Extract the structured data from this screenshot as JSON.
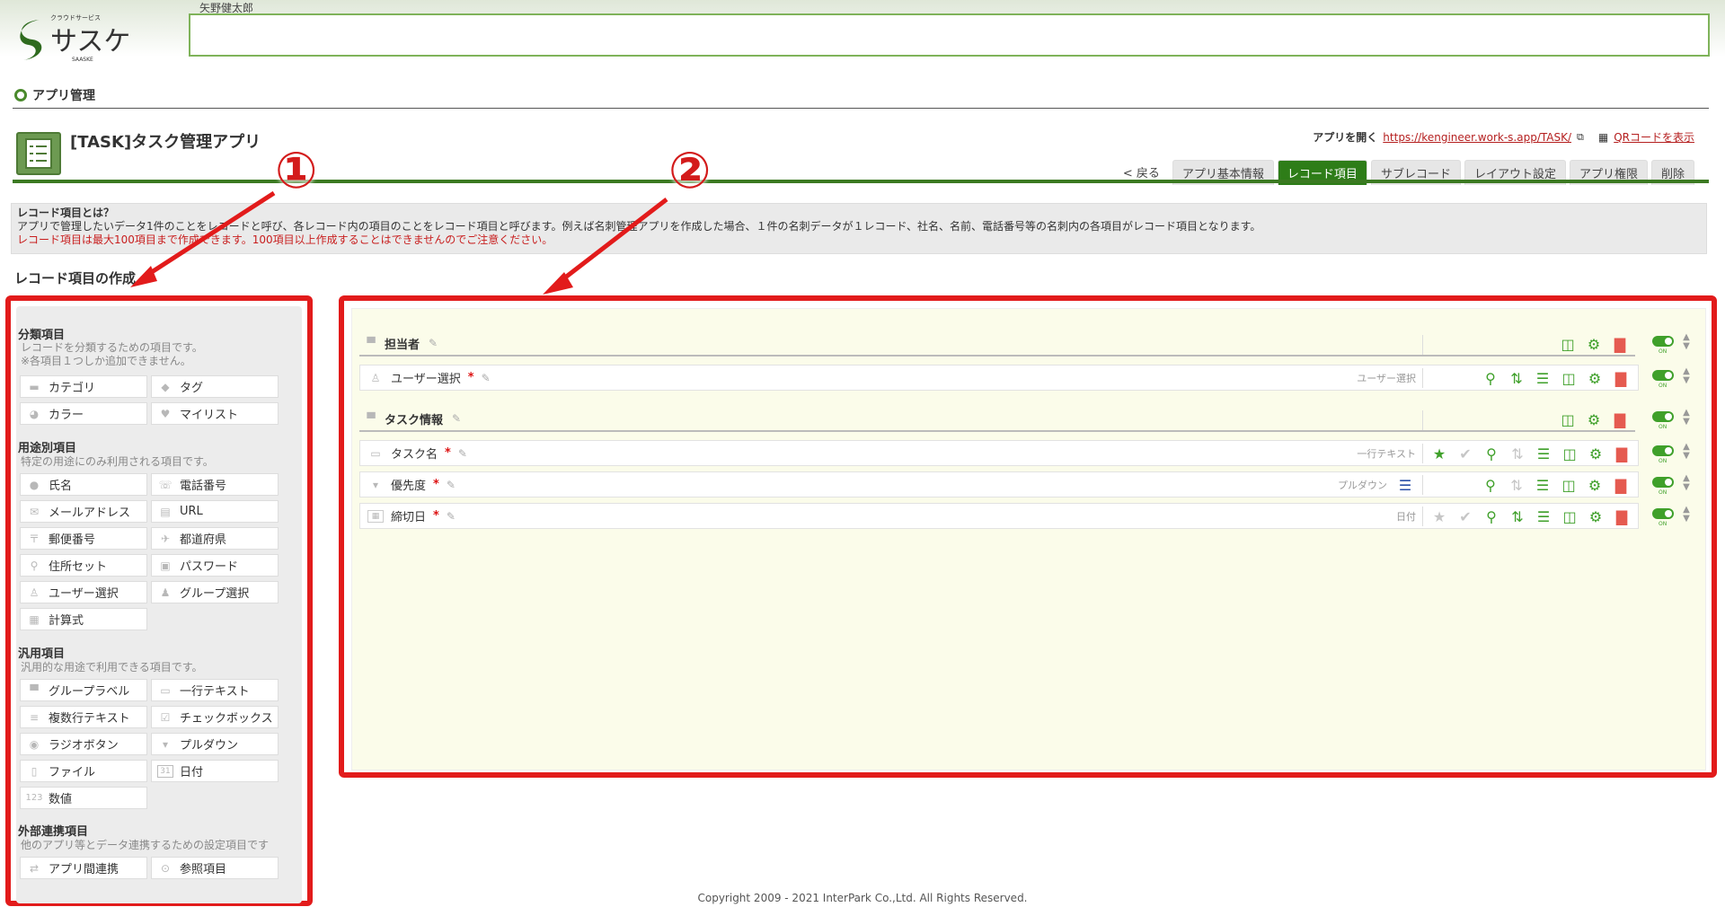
{
  "header": {
    "logo_small": "クラウドサービス",
    "logo_text": "サスケ",
    "logo_sub": "SAASKE",
    "user_name": "矢野健太郎"
  },
  "breadcrumb": "アプリ管理",
  "app": {
    "title": "[TASK]タスク管理アプリ",
    "open_label": "アプリを開く",
    "url": "https://kengineer.work-s.app/TASK/",
    "qr_label": "QRコードを表示"
  },
  "tabs": [
    "< 戻る",
    "アプリ基本情報",
    "レコード項目",
    "サブレコード",
    "レイアウト設定",
    "アプリ権限",
    "削除"
  ],
  "info": {
    "title": "レコード項目とは？",
    "line1": "アプリで管理したいデータ1件のことをレコードと呼び、各レコード内の項目のことをレコード項目と呼びます。例えば名刺管理アプリを作成した場合、１件の名刺データが１レコード、社名、名前、電話番号等の名刺内の各項目がレコード項目となります。",
    "line2": "レコード項目は最大100項目まで作成できます。100項目以上作成することはできませんのでご注意ください。"
  },
  "section_title": "レコード項目の作成",
  "left_panel": {
    "categories": [
      {
        "name": "分類項目",
        "desc": [
          "レコードを分類するための項目です。",
          "※各項目１つしか追加できません。"
        ],
        "items": [
          {
            "label": "カテゴリ",
            "icon": "folder-icon"
          },
          {
            "label": "タグ",
            "icon": "tag-icon"
          },
          {
            "label": "カラー",
            "icon": "palette-icon"
          },
          {
            "label": "マイリスト",
            "icon": "heart-icon"
          }
        ]
      },
      {
        "name": "用途別項目",
        "desc": [
          "特定の用途にのみ利用される項目です。"
        ],
        "items": [
          {
            "label": "氏名",
            "icon": "person-icon"
          },
          {
            "label": "電話番号",
            "icon": "phone-icon"
          },
          {
            "label": "メールアドレス",
            "icon": "mail-icon"
          },
          {
            "label": "URL",
            "icon": "url-icon"
          },
          {
            "label": "郵便番号",
            "icon": "postal-icon"
          },
          {
            "label": "都道府県",
            "icon": "map-icon"
          },
          {
            "label": "住所セット",
            "icon": "pin-icon"
          },
          {
            "label": "パスワード",
            "icon": "lock-icon"
          },
          {
            "label": "ユーザー選択",
            "icon": "user-icon"
          },
          {
            "label": "グループ選択",
            "icon": "group-icon"
          },
          {
            "label": "計算式",
            "icon": "calc-icon"
          }
        ]
      },
      {
        "name": "汎用項目",
        "desc": [
          "汎用的な用途で利用できる項目です。"
        ],
        "items": [
          {
            "label": "グループラベル",
            "icon": "bookmark-icon"
          },
          {
            "label": "一行テキスト",
            "icon": "single-line-icon"
          },
          {
            "label": "複数行テキスト",
            "icon": "multi-line-icon"
          },
          {
            "label": "チェックボックス",
            "icon": "checkbox-icon"
          },
          {
            "label": "ラジオボタン",
            "icon": "radio-icon"
          },
          {
            "label": "プルダウン",
            "icon": "dropdown-icon"
          },
          {
            "label": "ファイル",
            "icon": "file-icon"
          },
          {
            "label": "日付",
            "icon": "calendar-icon"
          },
          {
            "label": "数値",
            "icon": "number-icon"
          }
        ]
      },
      {
        "name": "外部連携項目",
        "desc": [
          "他のアプリ等とデータ連携するための設定項目です"
        ],
        "items": [
          {
            "label": "アプリ間連携",
            "icon": "link-icon"
          },
          {
            "label": "参照項目",
            "icon": "reference-icon"
          }
        ]
      }
    ],
    "number_glyph": "123",
    "calendar_glyph": "31"
  },
  "fields": {
    "group1": "担当者",
    "user_field": {
      "label": "ユーザー選択",
      "type": "ユーザー選択"
    },
    "group2": "タスク情報",
    "task_name": {
      "label": "タスク名",
      "type": "一行テキスト"
    },
    "priority": {
      "label": "優先度",
      "type": "プルダウン"
    },
    "due_date": {
      "label": "締切日",
      "type": "日付"
    },
    "required_mark": "*",
    "toggle_text": "ON"
  },
  "annotations": {
    "one": "①",
    "two": "②"
  },
  "colors": {
    "accent": "#2e7d18",
    "annotation_red": "#e21b1b",
    "icon_green": "#3fa02a"
  },
  "copyright": "Copyright 2009 - 2021 InterPark Co.,Ltd. All Rights Reserved."
}
